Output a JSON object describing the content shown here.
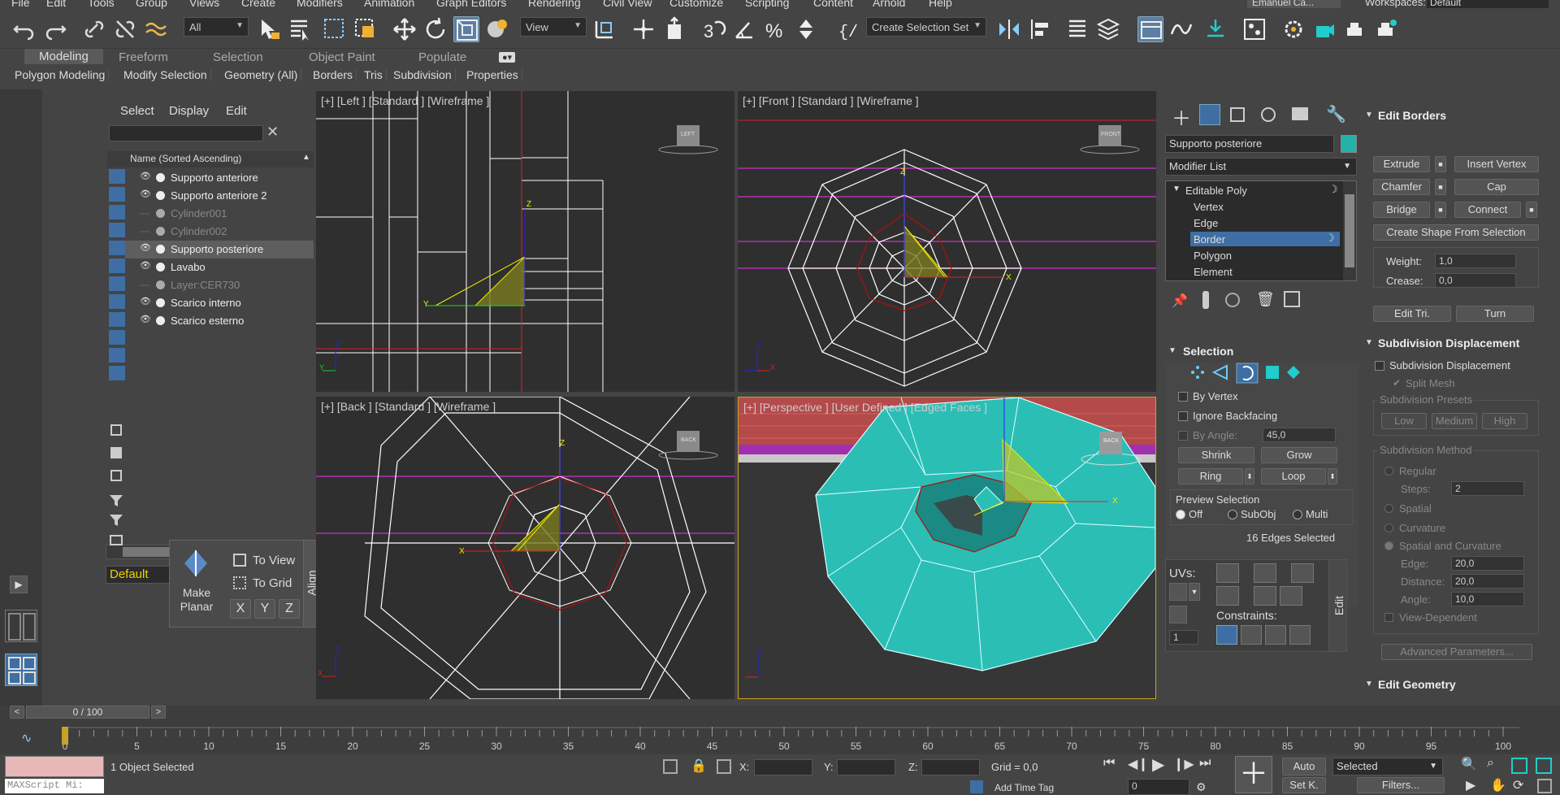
{
  "menu": [
    "File",
    "Edit",
    "Tools",
    "Group",
    "Views",
    "Create",
    "Modifiers",
    "Animation",
    "Graph Editors",
    "Rendering",
    "Civil View",
    "Customize",
    "Scripting",
    "Content",
    "Arnold",
    "Help"
  ],
  "user": "Emanuel Ca...",
  "workspace": {
    "label": "Workspaces:",
    "value": "Default"
  },
  "toolbar": {
    "filter": "All",
    "refcoord": "View",
    "selection_set": "Create Selection Set"
  },
  "ribbon_tabs": [
    "Modeling",
    "Freeform",
    "Selection",
    "Object Paint",
    "Populate"
  ],
  "ribbon_sub": [
    "Polygon Modeling",
    "Modify Selection",
    "Geometry (All)",
    "Borders",
    "Tris",
    "Subdivision",
    "Properties"
  ],
  "scene_explorer": {
    "menu": [
      "Select",
      "Display",
      "Edit"
    ],
    "column": "Name (Sorted Ascending)",
    "items": [
      {
        "name": "Supporto anteriore",
        "visible": true,
        "dim": false,
        "selected": false
      },
      {
        "name": "Supporto anteriore 2",
        "visible": true,
        "dim": false,
        "selected": false
      },
      {
        "name": "Cylinder001",
        "visible": false,
        "dim": true,
        "selected": false
      },
      {
        "name": "Cylinder002",
        "visible": false,
        "dim": true,
        "selected": false
      },
      {
        "name": "Supporto posteriore",
        "visible": true,
        "dim": false,
        "selected": true
      },
      {
        "name": "Lavabo",
        "visible": true,
        "dim": false,
        "selected": false
      },
      {
        "name": "Layer:CER730",
        "visible": false,
        "dim": true,
        "selected": false
      },
      {
        "name": "Scarico interno",
        "visible": true,
        "dim": false,
        "selected": false
      },
      {
        "name": "Scarico esterno",
        "visible": true,
        "dim": false,
        "selected": false
      }
    ],
    "layer": "Default"
  },
  "align_caddy": {
    "make_planar": "Make Planar",
    "to_view": "To View",
    "to_grid": "To Grid",
    "x": "X",
    "y": "Y",
    "z": "Z",
    "title": "Align"
  },
  "viewports": {
    "left": "[+] [Left ] [Standard ] [Wireframe ]",
    "front": "[+] [Front ] [Standard ] [Wireframe ]",
    "back": "[+] [Back ] [Standard ] [Wireframe ]",
    "persp": "[+] [Perspective ] [User Defined ] [Edged Faces ]",
    "cube_left": "LEFT",
    "cube_front": "FRONT",
    "cube_back": "BACK"
  },
  "command_panel": {
    "object_name": "Supporto posteriore",
    "object_color": "#21b3a6",
    "modifier_list": "Modifier List",
    "stack": [
      "Editable Poly",
      "Vertex",
      "Edge",
      "Border",
      "Polygon",
      "Element"
    ],
    "selection": {
      "title": "Selection",
      "by_vertex": "By Vertex",
      "ignore_backfacing": "Ignore Backfacing",
      "by_angle": "By Angle:",
      "by_angle_val": "45,0",
      "shrink": "Shrink",
      "grow": "Grow",
      "ring": "Ring",
      "loop": "Loop",
      "preview": "Preview Selection",
      "off": "Off",
      "subobj": "SubObj",
      "multi": "Multi",
      "status": "16 Edges Selected",
      "uvs": "UVs:",
      "constraints": "Constraints:",
      "spin_val": "1",
      "edit": "Edit"
    },
    "edit_borders": {
      "title": "Edit Borders",
      "extrude": "Extrude",
      "insert_vertex": "Insert Vertex",
      "chamfer": "Chamfer",
      "cap": "Cap",
      "bridge": "Bridge",
      "connect": "Connect",
      "create_shape": "Create Shape From Selection",
      "weight": "Weight:",
      "weight_val": "1,0",
      "crease": "Crease:",
      "crease_val": "0,0",
      "edit_tri": "Edit Tri.",
      "turn": "Turn"
    },
    "subdiv": {
      "title": "Subdivision Displacement",
      "check": "Subdivision Displacement",
      "split_mesh": "Split Mesh",
      "presets": "Subdivision Presets",
      "low": "Low",
      "medium": "Medium",
      "high": "High",
      "method": "Subdivision Method",
      "regular": "Regular",
      "steps": "Steps:",
      "steps_val": "2",
      "spatial": "Spatial",
      "curvature": "Curvature",
      "spatial_curv": "Spatial and Curvature",
      "edge": "Edge:",
      "edge_val": "20,0",
      "distance": "Distance:",
      "distance_val": "20,0",
      "angle": "Angle:",
      "angle_val": "10,0",
      "view_dep": "View-Dependent",
      "adv": "Advanced Parameters..."
    },
    "edit_geometry": "Edit Geometry"
  },
  "timeline": {
    "frame": "0 / 100",
    "ticks": [
      "0",
      "5",
      "10",
      "15",
      "20",
      "25",
      "30",
      "35",
      "40",
      "45",
      "50",
      "55",
      "60",
      "65",
      "70",
      "75",
      "80",
      "85",
      "90",
      "95",
      "100"
    ]
  },
  "status": {
    "maxscript": "MAXScript Mi:",
    "selected": "1 Object Selected",
    "x": "X:",
    "y": "Y:",
    "z": "Z:",
    "grid": "Grid = 0,0",
    "add_time_tag": "Add Time Tag",
    "auto": "Auto",
    "set_key": "Set K.",
    "sel_dd": "Selected",
    "filters": "Filters...",
    "frame_val": "0"
  }
}
